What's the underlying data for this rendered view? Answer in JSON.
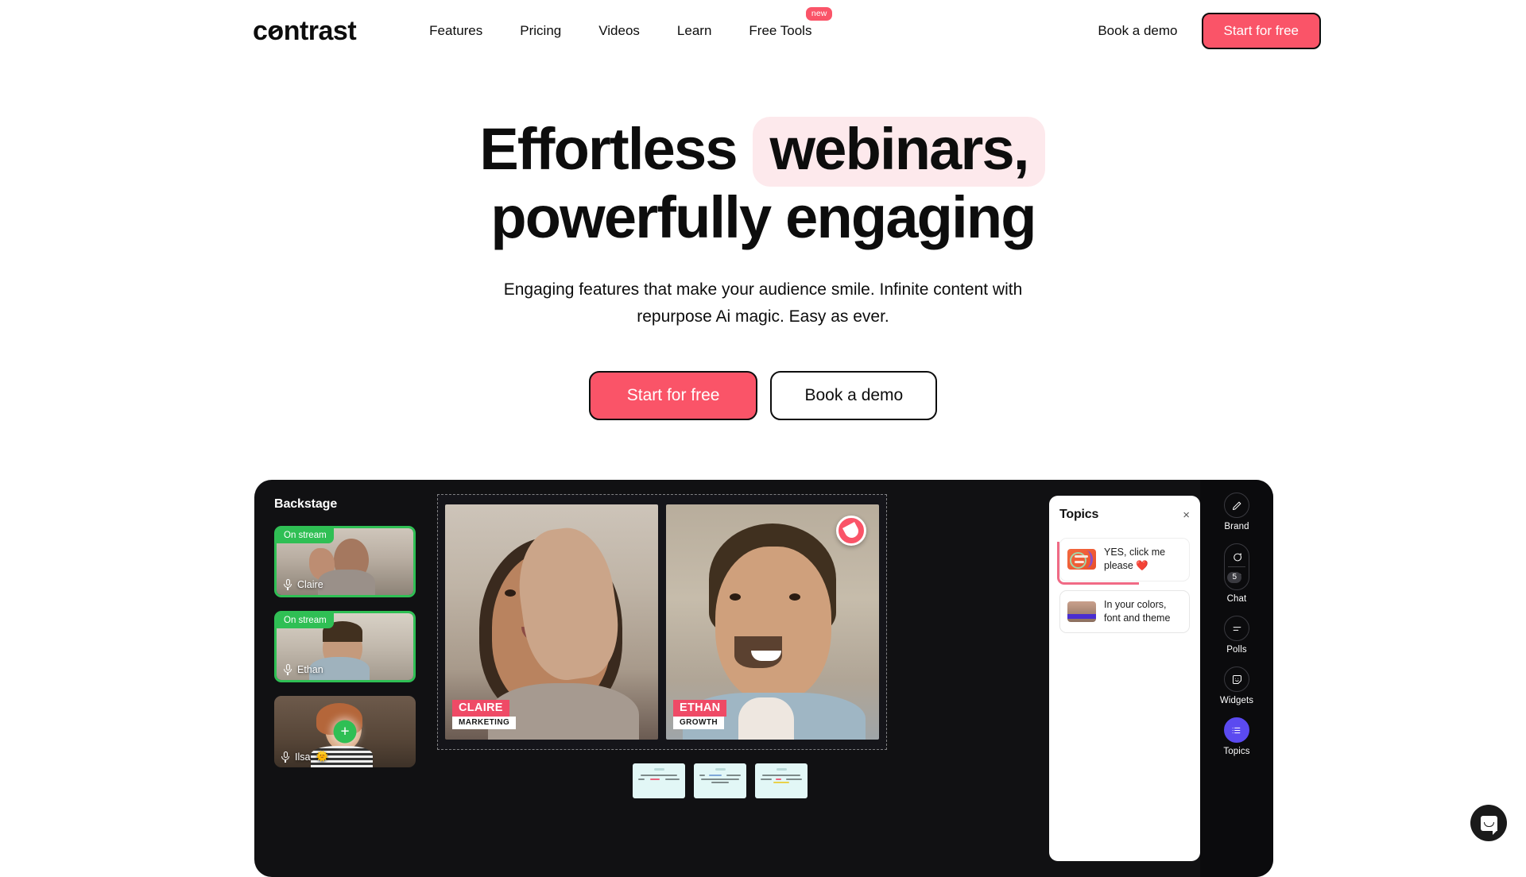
{
  "nav": {
    "logo": "contrast",
    "links": [
      {
        "label": "Features",
        "badge": null
      },
      {
        "label": "Pricing",
        "badge": null
      },
      {
        "label": "Videos",
        "badge": null
      },
      {
        "label": "Learn",
        "badge": null
      },
      {
        "label": "Free Tools",
        "badge": "new"
      }
    ],
    "demo_label": "Book a demo",
    "cta_label": "Start for free"
  },
  "hero": {
    "title_part1": "Effortless",
    "title_highlight": "webinars,",
    "title_part2": "powerfully engaging",
    "subtitle": "Engaging features that make your audience smile. Infinite content with repurpose Ai magic. Easy as ever.",
    "primary_cta": "Start for free",
    "secondary_cta": "Book a demo"
  },
  "app": {
    "backstage": {
      "title": "Backstage",
      "participants": [
        {
          "name": "Claire",
          "status": "On stream",
          "live": true,
          "emoji": ""
        },
        {
          "name": "Ethan",
          "status": "On stream",
          "live": true,
          "emoji": ""
        },
        {
          "name": "Ilsa",
          "status": "",
          "live": false,
          "emoji": "🌞"
        }
      ],
      "add_label": "+"
    },
    "stage": {
      "speakers": [
        {
          "name": "CLAIRE",
          "role": "MARKETING"
        },
        {
          "name": "ETHAN",
          "role": "GROWTH"
        }
      ]
    },
    "topics": {
      "title": "Topics",
      "close": "×",
      "items": [
        {
          "text": "YES, click me please ❤️",
          "active": true
        },
        {
          "text": "In your colors, font and theme",
          "active": false
        }
      ]
    },
    "rail": [
      {
        "label": "Brand",
        "icon": "pencil-icon",
        "badge": null,
        "active": false
      },
      {
        "label": "Chat",
        "icon": "chat-people-icon",
        "badge": "5",
        "active": false
      },
      {
        "label": "Polls",
        "icon": "polls-icon",
        "badge": null,
        "active": false
      },
      {
        "label": "Widgets",
        "icon": "sticker-icon",
        "badge": null,
        "active": false
      },
      {
        "label": "Topics",
        "icon": "list-icon",
        "badge": null,
        "active": true
      }
    ]
  },
  "colors": {
    "accent": "#fa5468",
    "highlight": "#fde9ec",
    "live_green": "#2fbf54",
    "active_purple": "#5b4af0",
    "dark_bg": "#111113"
  }
}
